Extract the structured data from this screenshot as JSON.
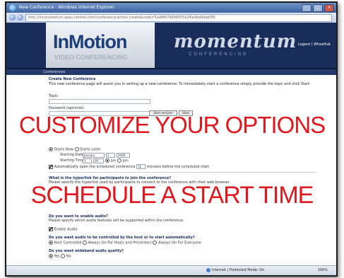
{
  "window": {
    "title": "New Conference - Windows Internet Explorer"
  },
  "address": {
    "url": "http://inconventium.apps.central.com/conference/action.create&code=5ad9fb7b6f4f0f3a2f6ad0a6bab0f8"
  },
  "header": {
    "logo_main": "InMotion",
    "logo_sub": "VIDEO CONFERENCING",
    "logo_partner": "momentum",
    "logo_partner_sub": "CONFERENCING",
    "links": "Logout | Wheelhat"
  },
  "nav": {
    "label": "Conferences"
  },
  "form": {
    "heading": "Create New Conference",
    "intro": "This new conference page will assist you in setting up a new conference. To immediately start a conference simply provide the topic and click Start",
    "topic_label": "Topic:",
    "password_label": "Password (optional):",
    "start_join_button": "Start and Join",
    "start_button": "Start",
    "starts_now": "Starts Now",
    "starts_later": "Starts Later",
    "starting_date_label": "Starting Date:",
    "month": "January",
    "day": "1",
    "year": "2009",
    "starting_time_label": "Starting Time:",
    "hour": "1",
    "minute": "00",
    "am": "am",
    "pm": "pm",
    "auto_open_label": "Automatically open the scheduled conference",
    "auto_open_minutes": "15",
    "auto_open_suffix": "minutes before the scheduled start.",
    "hyperlink_question": "What is the hyperlink for participants to join the conference?",
    "hyperlink_help": "Please specify the hyperlink used by participants to connect to the conference with their web browser",
    "audio_question": "Do you want to enable audio?",
    "audio_help": "Please specify which audio features will be supported within the conference.",
    "enable_audio": "Enable Audio",
    "audio_control_question": "Do you want audio to be controlled by the host or to start automatically?",
    "host_controlled": "Host Controlled",
    "always_on_hosts": "Always On For Hosts and Presenters",
    "always_on_everyone": "Always On For Everyone",
    "wideband_question": "Do you want wideband audio quality?",
    "yes": "Yes",
    "no": "No"
  },
  "overlay": {
    "line1": "CUSTOMIZE YOUR OPTIONS",
    "line2": "SCHEDULE A START TIME"
  },
  "status": {
    "zone": "Internet | Protected Mode: On",
    "zoom": "100%"
  },
  "colors": {
    "brand_navy": "#1a2d5a",
    "overlay_red": "#e0171c"
  }
}
